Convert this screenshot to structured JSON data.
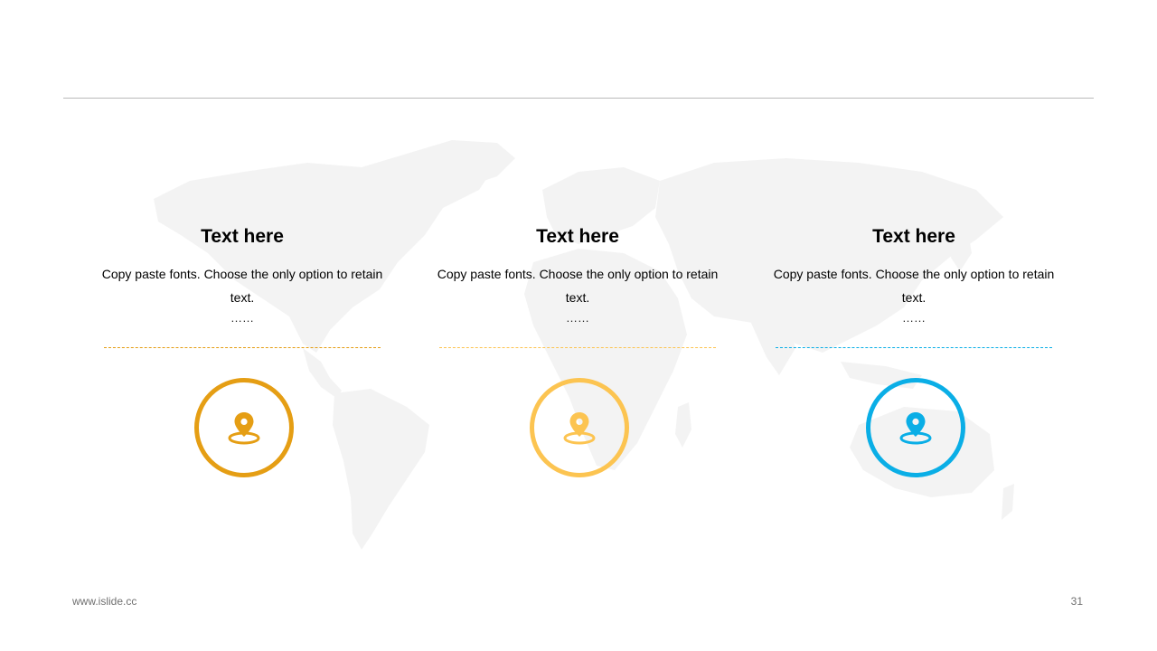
{
  "cards": [
    {
      "title": "Text here",
      "body": "Copy paste fonts. Choose the only option to retain text.",
      "ellipsis": "……",
      "accent": "#e59e14",
      "icon": "location-pin-icon"
    },
    {
      "title": "Text here",
      "body": "Copy paste fonts. Choose the only option to retain text.",
      "ellipsis": "……",
      "accent": "#fcc451",
      "icon": "location-pin-icon"
    },
    {
      "title": "Text here",
      "body": "Copy paste fonts. Choose the only option to retain text.",
      "ellipsis": "……",
      "accent": "#0aaee6",
      "icon": "location-pin-icon"
    }
  ],
  "footer": {
    "website": "www.islide.cc",
    "page_number": "31"
  },
  "colors": {
    "rule": "#b9b9b9",
    "map": "#f4f4f4"
  }
}
